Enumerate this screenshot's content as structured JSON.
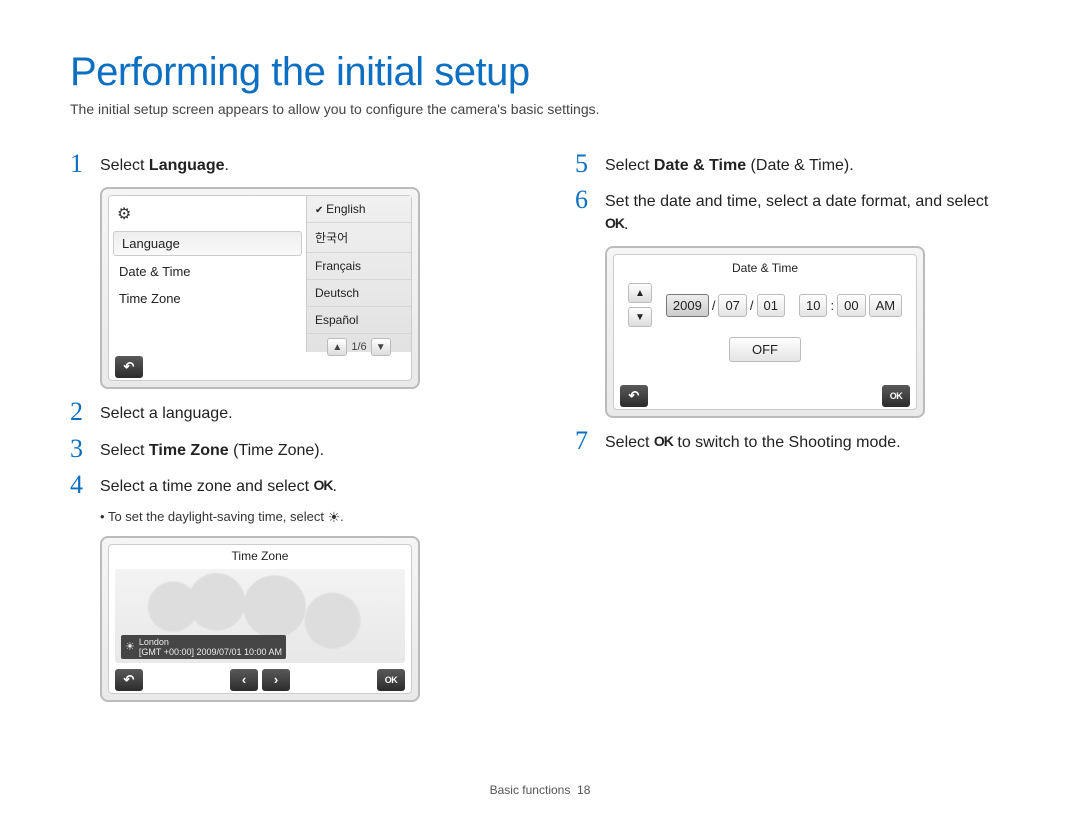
{
  "title": "Performing the initial setup",
  "intro": "The initial setup screen appears to allow you to configure the camera's basic settings.",
  "steps": {
    "s1": {
      "num": "1",
      "text_pre": "Select ",
      "bold": "Language",
      "text_post": "."
    },
    "s2": {
      "num": "2",
      "text": "Select a language."
    },
    "s3": {
      "num": "3",
      "text_pre": "Select ",
      "bold": "Time Zone",
      "text_post": " (Time Zone)."
    },
    "s4": {
      "num": "4",
      "text_pre": "Select a time zone and select ",
      "ok": "OK",
      "text_post": "."
    },
    "s4_sub": "To set the daylight-saving time, select ",
    "s5": {
      "num": "5",
      "text_pre": "Select ",
      "bold": "Date & Time",
      "text_post": " (Date & Time)."
    },
    "s6": {
      "num": "6",
      "text_pre": "Set the date and time, select a date format, and select ",
      "ok": "OK",
      "text_post": "."
    },
    "s7": {
      "num": "7",
      "text_pre": "Select ",
      "ok": "OK",
      "text_post": " to switch to the Shooting mode."
    }
  },
  "lang_screen": {
    "menu": {
      "item1": "Language",
      "item2": "Date & Time",
      "item3": "Time Zone"
    },
    "options": {
      "o1": "English",
      "o2": "한국어",
      "o3": "Français",
      "o4": "Deutsch",
      "o5": "Español"
    },
    "pager": "1/6"
  },
  "tz_screen": {
    "title": "Time Zone",
    "city": "London",
    "detail": "[GMT +00:00] 2009/07/01 10:00 AM",
    "ok": "OK"
  },
  "dt_screen": {
    "title": "Date & Time",
    "year": "2009",
    "sep1": "/",
    "month": "07",
    "sep2": "/",
    "day": "01",
    "hour": "10",
    "sep3": ":",
    "min": "00",
    "ampm": "AM",
    "off": "OFF",
    "ok": "OK"
  },
  "footer": {
    "section": "Basic functions",
    "page": "18"
  }
}
